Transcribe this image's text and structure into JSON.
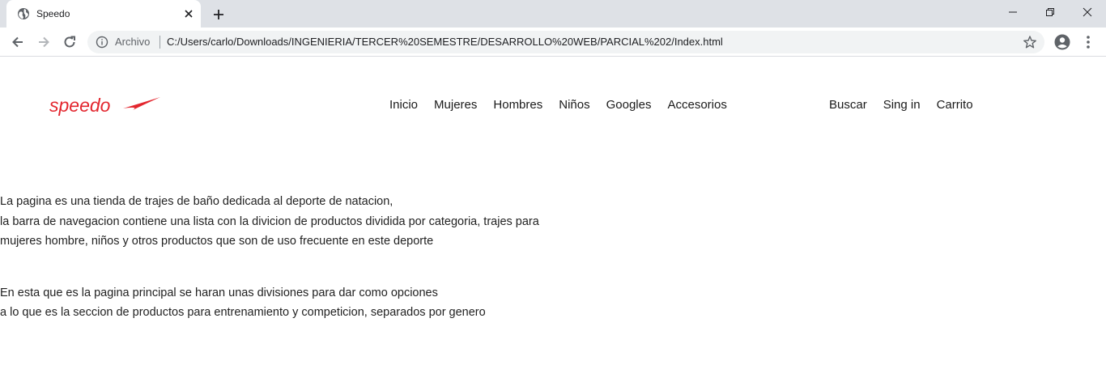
{
  "browser": {
    "tab_title": "Speedo",
    "origin_chip": "Archivo",
    "url": "C:/Users/carlo/Downloads/INGENIERIA/TERCER%20SEMESTRE/DESARROLLO%20WEB/PARCIAL%202/Index.html"
  },
  "site": {
    "logo_text": "speedo",
    "brand_color": "#e3262e",
    "nav_main": [
      "Inicio",
      "Mujeres",
      "Hombres",
      "Niños",
      "Googles",
      "Accesorios"
    ],
    "nav_right": [
      "Buscar",
      "Sing in",
      "Carrito"
    ]
  },
  "content": {
    "paragraphs": [
      {
        "lines": [
          "La pagina es una tienda de trajes de baño dedicada al deporte de natacion,",
          "la barra de navegacion contiene una lista con la divicion de productos dividida por categoria, trajes para",
          "mujeres hombre, niños y otros productos que son de uso frecuente en este deporte"
        ]
      },
      {
        "lines": [
          "En esta que es la pagina principal se haran unas divisiones para dar como opciones",
          "a lo que es la seccion de productos para entrenamiento y competicion, separados por genero"
        ]
      }
    ]
  }
}
